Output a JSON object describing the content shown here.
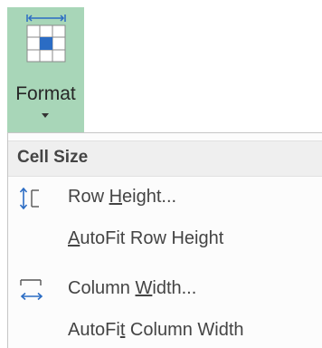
{
  "ribbon": {
    "format_button": {
      "label": "Format",
      "icon": "format-cells-icon",
      "caret_icon": "chevron-down-icon",
      "background": "#a8d6b8"
    }
  },
  "menu": {
    "section_header": "Cell Size",
    "items": [
      {
        "pre": "Row ",
        "accel": "H",
        "post": "eight...",
        "icon": "row-height-icon"
      },
      {
        "pre": "",
        "accel": "A",
        "post": "utoFit Row Height",
        "icon": ""
      },
      {
        "pre": "Column ",
        "accel": "W",
        "post": "idth...",
        "icon": "column-width-icon"
      },
      {
        "pre": "AutoFi",
        "accel": "t",
        "post": " Column Width",
        "icon": ""
      }
    ]
  },
  "colors": {
    "accent_blue": "#2b6cc4",
    "text": "#444444"
  }
}
